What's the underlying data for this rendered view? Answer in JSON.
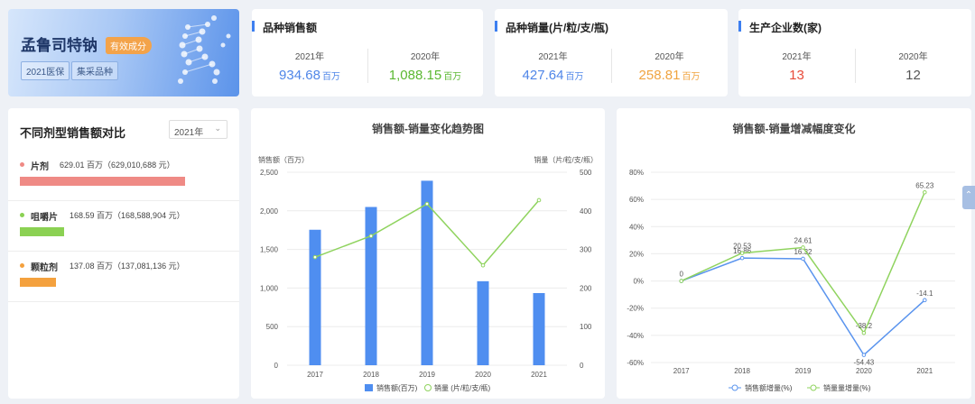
{
  "hero": {
    "title": "孟鲁司特钠",
    "badge": "有效成分",
    "tags": [
      "2021医保",
      "集采品种"
    ]
  },
  "stats": [
    {
      "title": "品种销售额",
      "cols": [
        {
          "year": "2021年",
          "value": "934.68",
          "unit": "百万",
          "color": "#4f86e8"
        },
        {
          "year": "2020年",
          "value": "1,088.15",
          "unit": "百万",
          "color": "#5bb832"
        }
      ]
    },
    {
      "title": "品种销量(片/粒/支/瓶)",
      "cols": [
        {
          "year": "2021年",
          "value": "427.64",
          "unit": "百万",
          "color": "#4f86e8"
        },
        {
          "year": "2020年",
          "value": "258.81",
          "unit": "百万",
          "color": "#f0a440"
        }
      ]
    },
    {
      "title": "生产企业数(家)",
      "cols": [
        {
          "year": "2021年",
          "value": "13",
          "unit": "",
          "color": "#e84b3a"
        },
        {
          "year": "2020年",
          "value": "12",
          "unit": "",
          "color": "#555555"
        }
      ]
    }
  ],
  "dosage": {
    "title": "不同剂型销售额对比",
    "select_value": "2021年",
    "max_value": 629.01,
    "items": [
      {
        "name": "片剂",
        "value": 629.01,
        "display": "629.01 百万（629,010,688 元）",
        "color": "#ef8a85"
      },
      {
        "name": "咀嚼片",
        "value": 168.59,
        "display": "168.59 百万（168,588,904 元）",
        "color": "#8bd153"
      },
      {
        "name": "颗粒剂",
        "value": 137.08,
        "display": "137.08 百万（137,081,136 元）",
        "color": "#f4a13e"
      }
    ]
  },
  "chart_data": [
    {
      "type": "bar",
      "title": "销售额-销量变化趋势图",
      "categories": [
        "2017",
        "2018",
        "2019",
        "2020",
        "2021"
      ],
      "left_axis_label": "销售额（百万）",
      "right_axis_label": "销量（片/粒/支/瓶）",
      "ylim_left": [
        0,
        2500
      ],
      "ylim_right": [
        0,
        500
      ],
      "left_ticks": [
        "0",
        "500",
        "1,000",
        "1,500",
        "2,000",
        "2,500"
      ],
      "right_ticks": [
        "0",
        "100",
        "200",
        "300",
        "400",
        "500"
      ],
      "series": [
        {
          "name": "销售额(百万)",
          "type": "bar",
          "axis": "left",
          "color": "#4f8ef0",
          "values": [
            1755,
            2050,
            2390,
            1088.15,
            934.68
          ]
        },
        {
          "name": "销量 (片/粒/支/瓶)",
          "type": "line",
          "axis": "right",
          "color": "#8fd35e",
          "values": [
            280,
            335,
            418,
            258.81,
            427.64
          ]
        }
      ],
      "grid": true,
      "legend": "bottom-center"
    },
    {
      "type": "line",
      "title": "销售额-销量增减幅度变化",
      "categories": [
        "2017",
        "2018",
        "2019",
        "2020",
        "2021"
      ],
      "ylim": [
        -60,
        80
      ],
      "y_ticks": [
        "-60%",
        "-40%",
        "-20%",
        "0%",
        "20%",
        "40%",
        "60%",
        "80%"
      ],
      "series": [
        {
          "name": "销售额增量(%)",
          "color": "#5a94ee",
          "values": [
            0,
            16.86,
            16.32,
            -54.43,
            -14.1
          ],
          "labels": [
            "0",
            "16.86",
            "16.32",
            "-54.43",
            "-14.1"
          ]
        },
        {
          "name": "销量量增量(%)",
          "color": "#8fd35e",
          "values": [
            0,
            20.53,
            24.61,
            -38.2,
            65.23
          ],
          "labels": [
            "",
            "20.53",
            "24.61",
            "-38.2",
            "65.23"
          ]
        }
      ],
      "grid": true,
      "legend": "bottom-center"
    }
  ]
}
